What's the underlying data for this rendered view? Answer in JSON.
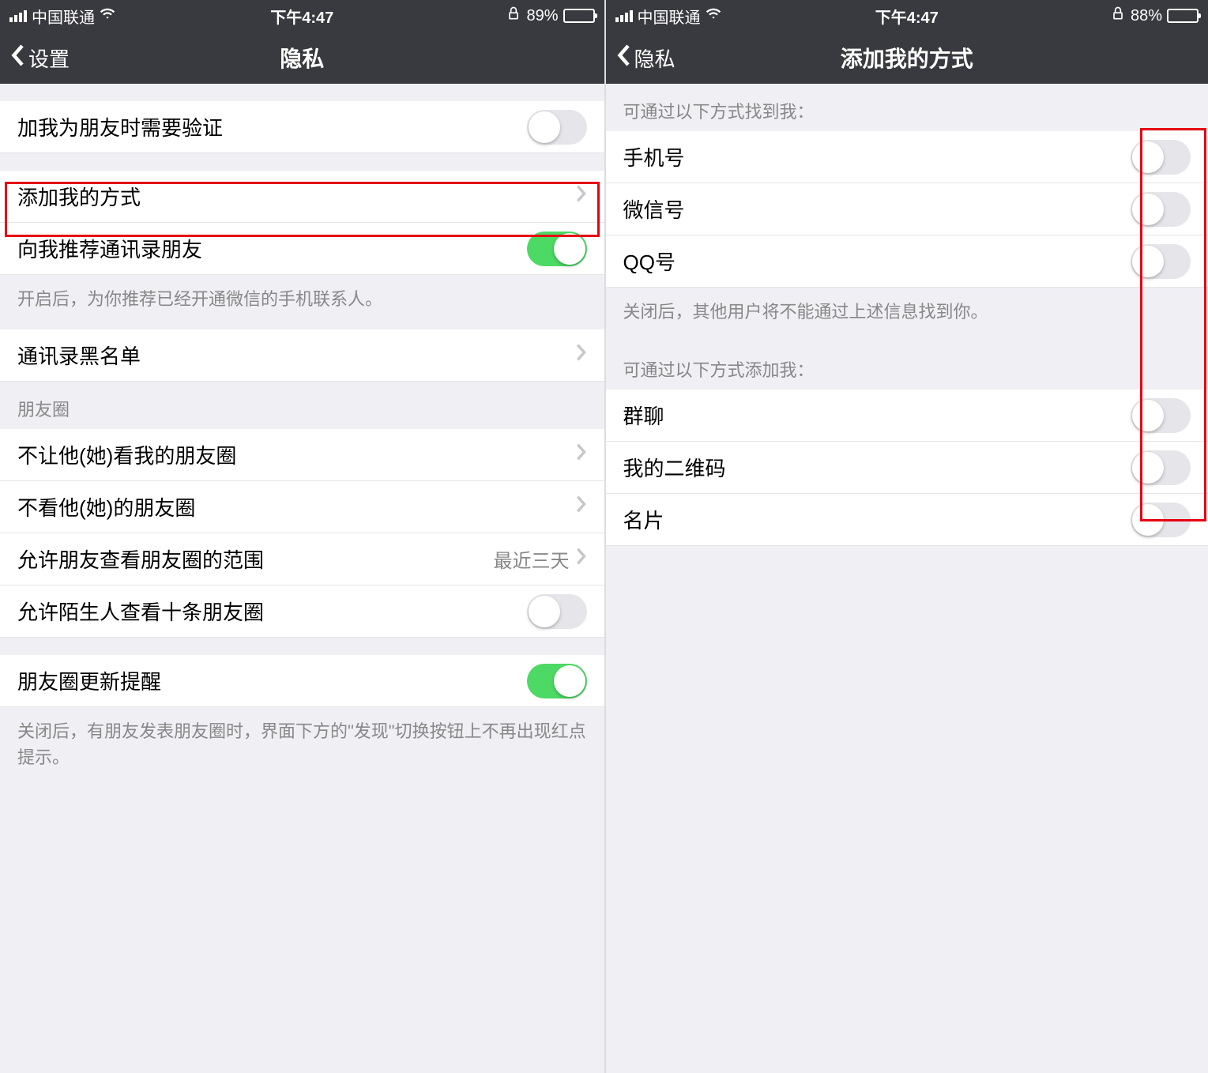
{
  "left": {
    "status": {
      "carrier": "中国联通",
      "time": "下午4:47",
      "battery": "89%"
    },
    "nav": {
      "back": "设置",
      "title": "隐私"
    },
    "rows": {
      "verify": "加我为朋友时需要验证",
      "add_ways": "添加我的方式",
      "recommend": "向我推荐通讯录朋友",
      "recommend_note": "开启后，为你推荐已经开通微信的手机联系人。",
      "blacklist": "通讯录黑名单",
      "moments_header": "朋友圈",
      "hide_my": "不让他(她)看我的朋友圈",
      "hide_their": "不看他(她)的朋友圈",
      "range": "允许朋友查看朋友圈的范围",
      "range_value": "最近三天",
      "strangers": "允许陌生人查看十条朋友圈",
      "update_notice": "朋友圈更新提醒",
      "update_note": "关闭后，有朋友发表朋友圈时，界面下方的\"发现\"切换按钮上不再出现红点提示。"
    },
    "toggles": {
      "verify": false,
      "recommend": true,
      "strangers": false,
      "update_notice": true
    }
  },
  "right": {
    "status": {
      "carrier": "中国联通",
      "time": "下午4:47",
      "battery": "88%"
    },
    "nav": {
      "back": "隐私",
      "title": "添加我的方式"
    },
    "headers": {
      "find": "可通过以下方式找到我：",
      "find_note": "关闭后，其他用户将不能通过上述信息找到你。",
      "add": "可通过以下方式添加我："
    },
    "rows": {
      "phone": "手机号",
      "wechat": "微信号",
      "qq": "QQ号",
      "group": "群聊",
      "qrcode": "我的二维码",
      "card": "名片"
    },
    "toggles": {
      "phone": false,
      "wechat": false,
      "qq": false,
      "group": false,
      "qrcode": false,
      "card": false
    }
  }
}
